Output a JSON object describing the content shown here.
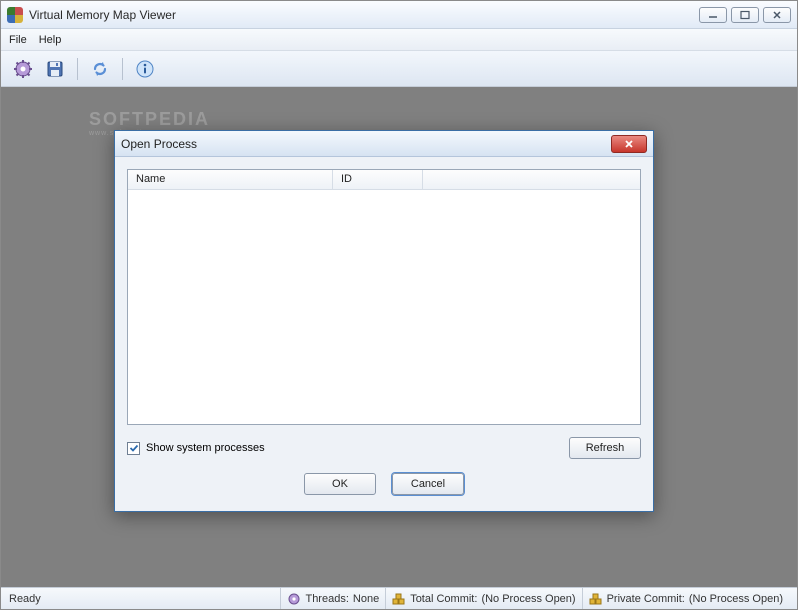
{
  "app": {
    "title": "Virtual Memory Map Viewer"
  },
  "menu": {
    "file": "File",
    "help": "Help"
  },
  "toolbar": {
    "settings_icon": "gear-icon",
    "save_icon": "save-icon",
    "refresh_icon": "refresh-icon",
    "about_icon": "info-icon"
  },
  "watermark": {
    "line1": "SOFTPEDIA",
    "line2": "www.softpedia.com"
  },
  "dialog": {
    "title": "Open Process",
    "columns": {
      "name": "Name",
      "id": "ID"
    },
    "rows": [],
    "show_system_processes": {
      "label": "Show system processes",
      "checked": true
    },
    "refresh": "Refresh",
    "ok": "OK",
    "cancel": "Cancel"
  },
  "status": {
    "ready": "Ready",
    "threads_label": "Threads:",
    "threads_value": "None",
    "total_commit_label": "Total Commit:",
    "total_commit_value": "(No Process Open)",
    "private_commit_label": "Private Commit:",
    "private_commit_value": "(No Process Open)"
  }
}
